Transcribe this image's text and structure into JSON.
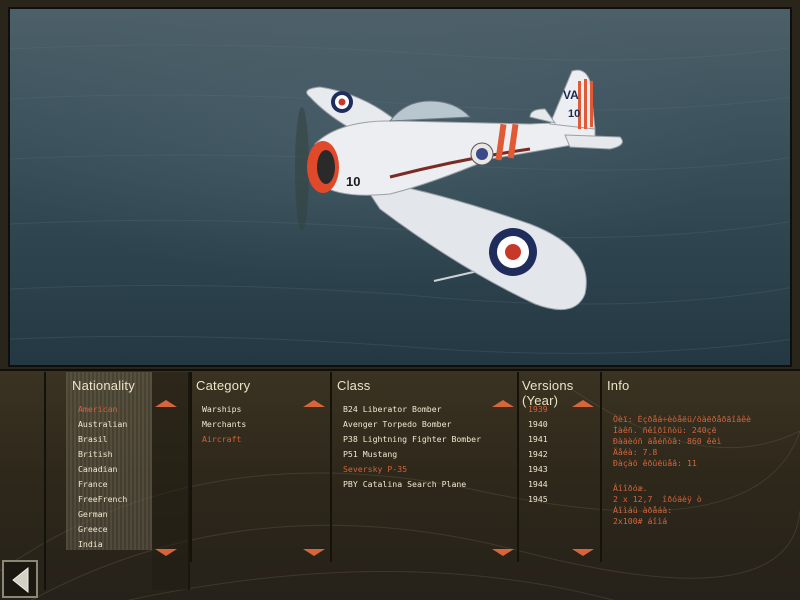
{
  "viewport": {
    "aircraft": {
      "tail_code": "VA",
      "tail_number": "10",
      "cowling_number": "10"
    }
  },
  "colors": {
    "panel_bg": "#2e281b",
    "text": "#efe8d0",
    "accent_selected": "#d2623a",
    "sea": "#2e4550"
  },
  "nationality": {
    "title": "Nationality",
    "selected_index": 0,
    "items": [
      "American",
      "Australian",
      "Brasil",
      "British",
      "Canadian",
      "France",
      "FreeFrench",
      "German",
      "Greece",
      "India"
    ]
  },
  "category": {
    "title": "Category",
    "selected_index": 2,
    "items": [
      "Warships",
      "Merchants",
      "Aircraft"
    ]
  },
  "class": {
    "title": "Class",
    "selected_index": 4,
    "items": [
      "B24 Liberator Bomber",
      "Avenger Torpedo Bomber",
      "P38 Lightning Fighter Bomber",
      "P51 Mustang",
      "Seversky P-35",
      "PBY Catalina Search Plane"
    ]
  },
  "versions": {
    "title": "Versions (Year)",
    "selected_index": 0,
    "items": [
      "1939",
      "1940",
      "1941",
      "1942",
      "1943",
      "1944",
      "1945"
    ]
  },
  "info": {
    "title": "Info",
    "lines": [
      "Òèï: Èçðåá÷èòåëü/öàëðåðãîâêè",
      "Ìàêñ. ñêîðîñòü: 240çë",
      "Ðàäèóñ äåéñòâ: 860 êëì",
      "Äåéà: 7.8",
      "Ðàçàõ êðûëüåâ: 11"
    ],
    "lines2": [
      "Âîîðóæ.",
      "2 x 12,7  îðóäèÿ ò",
      "Áîìáû àðåáà:",
      "2x100# áîìá"
    ]
  },
  "back_icon": "chevron-left-icon"
}
